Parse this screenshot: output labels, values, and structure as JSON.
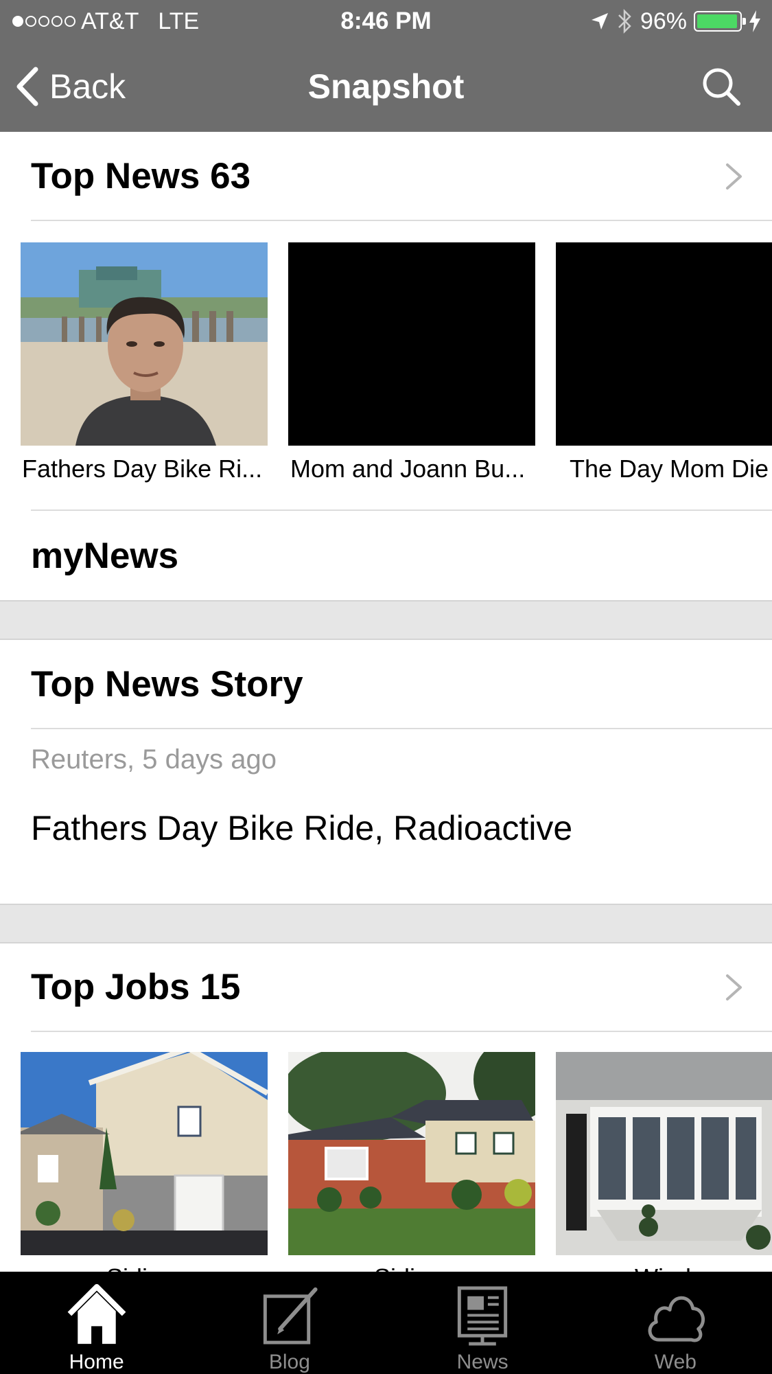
{
  "status_bar": {
    "carrier": "AT&T",
    "network": "LTE",
    "time": "8:46 PM",
    "battery": "96%",
    "battery_level": 0.96,
    "signal_bars_filled": 1,
    "signal_bars_total": 5
  },
  "nav": {
    "back_label": "Back",
    "title": "Snapshot"
  },
  "top_news": {
    "title": "Top News 63",
    "items": [
      {
        "caption": "Fathers Day Bike Ri..."
      },
      {
        "caption": "Mom and Joann Bu..."
      },
      {
        "caption": "The Day Mom Die"
      }
    ]
  },
  "my_news": {
    "title": "myNews"
  },
  "top_news_story": {
    "title": "Top News Story",
    "meta": "Reuters, 5 days ago",
    "headline": "Fathers Day Bike Ride, Radioactive"
  },
  "top_jobs": {
    "title": "Top Jobs 15",
    "items": [
      {
        "caption": "Sidin"
      },
      {
        "caption": "Sidin"
      },
      {
        "caption": "Wind"
      }
    ]
  },
  "tabs": [
    {
      "label": "Home",
      "icon": "home-icon",
      "active": true
    },
    {
      "label": "Blog",
      "icon": "blog-icon",
      "active": false
    },
    {
      "label": "News",
      "icon": "news-icon",
      "active": false
    },
    {
      "label": "Web",
      "icon": "cloud-icon",
      "active": false
    }
  ],
  "colors": {
    "bar_gray": "#6d6d6d",
    "battery_green": "#4cd964",
    "band_gray": "#e6e6e6",
    "meta_gray": "#9a9a9a",
    "tab_bg": "#000000"
  }
}
